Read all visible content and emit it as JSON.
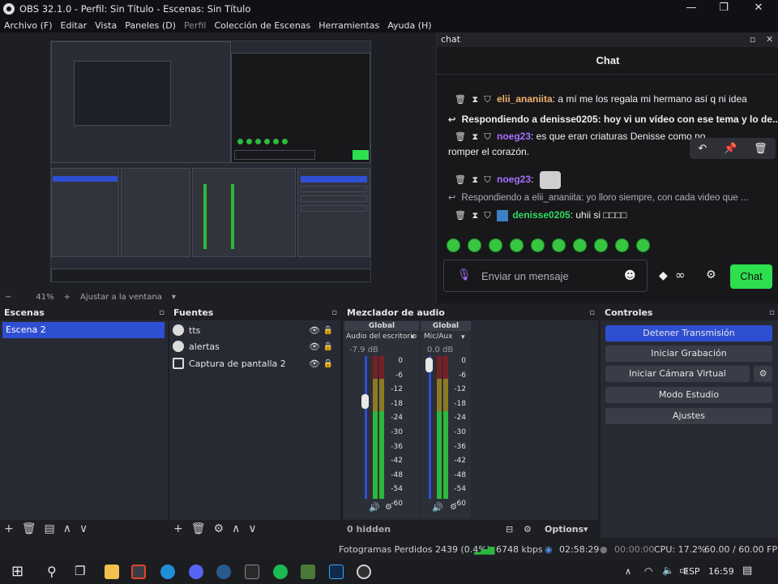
{
  "window": {
    "title": "OBS 32.1.0 - Perfil: Sin Título - Escenas: Sin Título",
    "minimize": "—",
    "maximize": "❐",
    "close": "✕"
  },
  "menu": [
    "Archivo (F)",
    "Editar",
    "Vista",
    "Paneles (D)",
    "Perfil",
    "Colección de Escenas",
    "Herramientas",
    "Ayuda (H)"
  ],
  "preview": {
    "zoom_minus": "−",
    "zoom": "41%",
    "zoom_plus": "+",
    "fit_label": "Ajustar a la ventana"
  },
  "chat": {
    "dock_title": "chat",
    "title": "Chat",
    "messages": [
      {
        "user": "elii_ananiita",
        "text": ": a mí me los regala mi hermano así q ni idea"
      },
      {
        "reply": "Respondiendo a denisse0205: hoy vi un vídeo con ese tema y lo de..."
      },
      {
        "user": "noeg23",
        "text": ": es que eran criaturas Denisse como no",
        "text2": "romper el corazón."
      },
      {
        "user": "noeg23",
        "text": ":"
      },
      {
        "reply": "Respondiendo a elii_ananiita: yo lloro siempre, con cada video que ..."
      },
      {
        "user": "denisse0205",
        "text": ": uhii si □□□□"
      }
    ],
    "input_placeholder": "Enviar un mensaje",
    "chat_button": "Chat"
  },
  "scenes": {
    "title": "Escenas",
    "items": [
      "Escena 2"
    ]
  },
  "sources": {
    "title": "Fuentes",
    "items": [
      "tts",
      "alertas",
      "Captura de pantalla 2"
    ]
  },
  "mixer": {
    "title": "Mezclador de audio",
    "channels": [
      {
        "badge": "Global",
        "name": "Audio del escritorio",
        "db": "-7.9 dB"
      },
      {
        "badge": "Global",
        "name": "Mic/Aux",
        "db": "0.0 dB"
      }
    ],
    "scale": [
      "0",
      "-6",
      "-12",
      "-18",
      "-24",
      "-30",
      "-36",
      "-42",
      "-48",
      "-54",
      "-60"
    ],
    "hidden": "0 hidden",
    "options": "Options"
  },
  "controls": {
    "title": "Controles",
    "buttons": [
      "Detener Transmisión",
      "Iniciar Grabación",
      "Iniciar Cámara Virtual",
      "Modo Estudio",
      "Ajustes"
    ]
  },
  "status": {
    "dropped": "Fotogramas Perdidos 2439 (0.4%)",
    "bitrate": "6748 kbps",
    "stream_time": "02:58:29",
    "rec_time": "00:00:00",
    "cpu": "CPU: 17.2%",
    "fps": "60.00 / 60.00 FPS"
  },
  "taskbar": {
    "lang": "ESP",
    "time": "16:59"
  },
  "colors": {
    "accent_blue": "#2f4fd3",
    "chat_green": "#2ee04e",
    "meter_green": "#2db83d"
  }
}
